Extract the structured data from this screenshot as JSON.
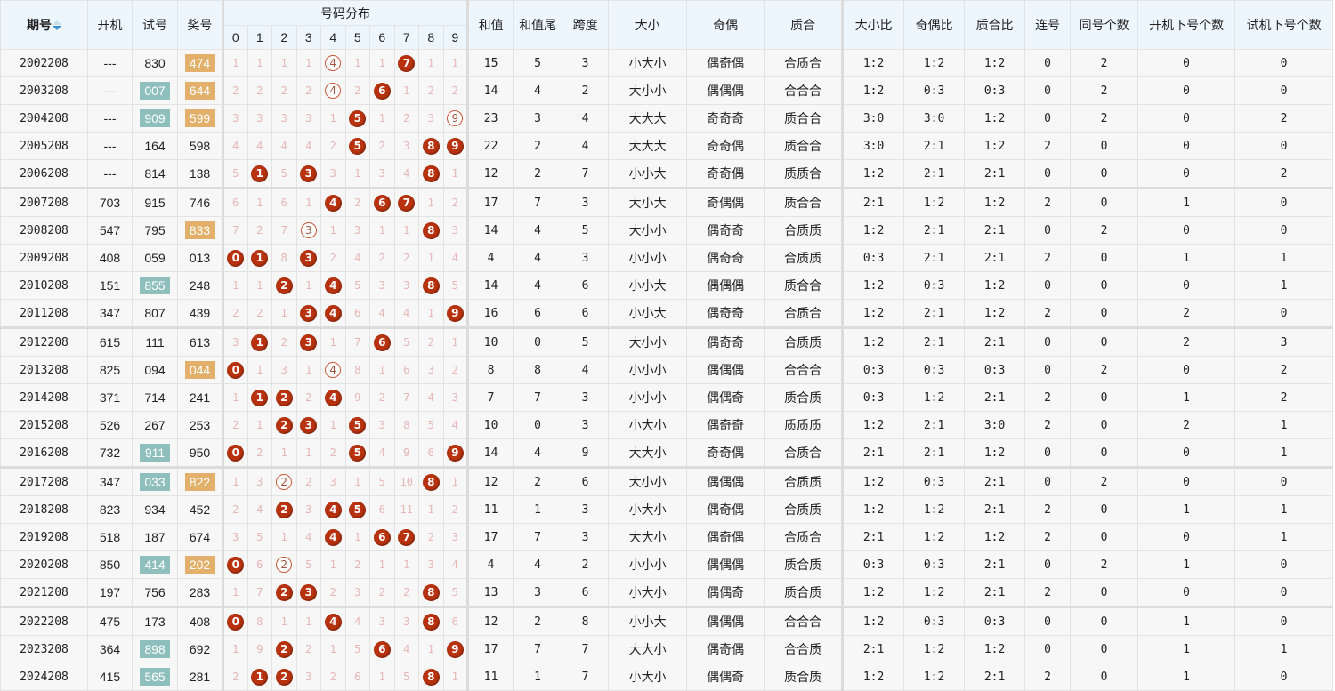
{
  "headers": {
    "issue": "期号",
    "open_machine": "开机",
    "test": "试号",
    "prize": "奖号",
    "distribution": "号码分布",
    "digits": [
      "0",
      "1",
      "2",
      "3",
      "4",
      "5",
      "6",
      "7",
      "8",
      "9"
    ],
    "sum": "和值",
    "sum_tail": "和值尾",
    "span": "跨度",
    "big_small": "大小",
    "odd_even": "奇偶",
    "prime_comp": "质合",
    "big_small_ratio": "大小比",
    "odd_even_ratio": "奇偶比",
    "prime_comp_ratio": "质合比",
    "consecutive": "连号",
    "same_count": "同号个数",
    "open_next_count": "开机下号个数",
    "test_next_count": "试机下号个数"
  },
  "sort_icon": "sort-updown-icon",
  "colors": {
    "ball": "#b8320f",
    "pair_ring": "#c9583a",
    "test_highlight": "#8fbfbd",
    "prize_highlight": "#e2b06a",
    "miss_text": "#e7b7b7",
    "header_bg": "#eef6fd"
  },
  "rows": [
    {
      "issue": "2002208",
      "open": "---",
      "test": "830",
      "test_hl": false,
      "prize": "474",
      "prize_hl": true,
      "dist": [
        "1",
        "1",
        "1",
        "1",
        "P4",
        "1",
        "1",
        "B7",
        "1",
        "1"
      ],
      "sum": "15",
      "tail": "5",
      "span": "3",
      "bs": "小大小",
      "oe": "偶奇偶",
      "pc": "合质合",
      "bsr": "1:2",
      "oer": "1:2",
      "pcr": "1:2",
      "cons": "0",
      "same": "2",
      "onext": "0",
      "tnext": "0"
    },
    {
      "issue": "2003208",
      "open": "---",
      "test": "007",
      "test_hl": true,
      "prize": "644",
      "prize_hl": true,
      "dist": [
        "2",
        "2",
        "2",
        "2",
        "P4",
        "2",
        "B6",
        "1",
        "2",
        "2"
      ],
      "sum": "14",
      "tail": "4",
      "span": "2",
      "bs": "大小小",
      "oe": "偶偶偶",
      "pc": "合合合",
      "bsr": "1:2",
      "oer": "0:3",
      "pcr": "0:3",
      "cons": "0",
      "same": "2",
      "onext": "0",
      "tnext": "0"
    },
    {
      "issue": "2004208",
      "open": "---",
      "test": "909",
      "test_hl": true,
      "prize": "599",
      "prize_hl": true,
      "dist": [
        "3",
        "3",
        "3",
        "3",
        "1",
        "B5",
        "1",
        "2",
        "3",
        "P9"
      ],
      "sum": "23",
      "tail": "3",
      "span": "4",
      "bs": "大大大",
      "oe": "奇奇奇",
      "pc": "质合合",
      "bsr": "3:0",
      "oer": "3:0",
      "pcr": "1:2",
      "cons": "0",
      "same": "2",
      "onext": "0",
      "tnext": "2"
    },
    {
      "issue": "2005208",
      "open": "---",
      "test": "164",
      "test_hl": false,
      "prize": "598",
      "prize_hl": false,
      "dist": [
        "4",
        "4",
        "4",
        "4",
        "2",
        "B5",
        "2",
        "3",
        "B8",
        "B9"
      ],
      "sum": "22",
      "tail": "2",
      "span": "4",
      "bs": "大大大",
      "oe": "奇奇偶",
      "pc": "质合合",
      "bsr": "3:0",
      "oer": "2:1",
      "pcr": "1:2",
      "cons": "2",
      "same": "0",
      "onext": "0",
      "tnext": "0"
    },
    {
      "issue": "2006208",
      "open": "---",
      "test": "814",
      "test_hl": false,
      "prize": "138",
      "prize_hl": false,
      "dist": [
        "5",
        "B1",
        "5",
        "B3",
        "3",
        "1",
        "3",
        "4",
        "B8",
        "1"
      ],
      "sum": "12",
      "tail": "2",
      "span": "7",
      "bs": "小小大",
      "oe": "奇奇偶",
      "pc": "质质合",
      "bsr": "1:2",
      "oer": "2:1",
      "pcr": "2:1",
      "cons": "0",
      "same": "0",
      "onext": "0",
      "tnext": "2"
    },
    {
      "issue": "2007208",
      "open": "703",
      "test": "915",
      "test_hl": false,
      "prize": "746",
      "prize_hl": false,
      "dist": [
        "6",
        "1",
        "6",
        "1",
        "B4",
        "2",
        "B6",
        "B7",
        "1",
        "2"
      ],
      "sum": "17",
      "tail": "7",
      "span": "3",
      "bs": "大小大",
      "oe": "奇偶偶",
      "pc": "质合合",
      "bsr": "2:1",
      "oer": "1:2",
      "pcr": "1:2",
      "cons": "2",
      "same": "0",
      "onext": "1",
      "tnext": "0"
    },
    {
      "issue": "2008208",
      "open": "547",
      "test": "795",
      "test_hl": false,
      "prize": "833",
      "prize_hl": true,
      "dist": [
        "7",
        "2",
        "7",
        "P3",
        "1",
        "3",
        "1",
        "1",
        "B8",
        "3"
      ],
      "sum": "14",
      "tail": "4",
      "span": "5",
      "bs": "大小小",
      "oe": "偶奇奇",
      "pc": "合质质",
      "bsr": "1:2",
      "oer": "2:1",
      "pcr": "2:1",
      "cons": "0",
      "same": "2",
      "onext": "0",
      "tnext": "0"
    },
    {
      "issue": "2009208",
      "open": "408",
      "test": "059",
      "test_hl": false,
      "prize": "013",
      "prize_hl": false,
      "dist": [
        "B0",
        "B1",
        "8",
        "B3",
        "2",
        "4",
        "2",
        "2",
        "1",
        "4"
      ],
      "sum": "4",
      "tail": "4",
      "span": "3",
      "bs": "小小小",
      "oe": "偶奇奇",
      "pc": "合质质",
      "bsr": "0:3",
      "oer": "2:1",
      "pcr": "2:1",
      "cons": "2",
      "same": "0",
      "onext": "1",
      "tnext": "1"
    },
    {
      "issue": "2010208",
      "open": "151",
      "test": "855",
      "test_hl": true,
      "prize": "248",
      "prize_hl": false,
      "dist": [
        "1",
        "1",
        "B2",
        "1",
        "B4",
        "5",
        "3",
        "3",
        "B8",
        "5"
      ],
      "sum": "14",
      "tail": "4",
      "span": "6",
      "bs": "小小大",
      "oe": "偶偶偶",
      "pc": "质合合",
      "bsr": "1:2",
      "oer": "0:3",
      "pcr": "1:2",
      "cons": "0",
      "same": "0",
      "onext": "0",
      "tnext": "1"
    },
    {
      "issue": "2011208",
      "open": "347",
      "test": "807",
      "test_hl": false,
      "prize": "439",
      "prize_hl": false,
      "dist": [
        "2",
        "2",
        "1",
        "B3",
        "B4",
        "6",
        "4",
        "4",
        "1",
        "B9"
      ],
      "sum": "16",
      "tail": "6",
      "span": "6",
      "bs": "小小大",
      "oe": "偶奇奇",
      "pc": "合质合",
      "bsr": "1:2",
      "oer": "2:1",
      "pcr": "1:2",
      "cons": "2",
      "same": "0",
      "onext": "2",
      "tnext": "0"
    },
    {
      "issue": "2012208",
      "open": "615",
      "test": "111",
      "test_hl": false,
      "prize": "613",
      "prize_hl": false,
      "dist": [
        "3",
        "B1",
        "2",
        "B3",
        "1",
        "7",
        "B6",
        "5",
        "2",
        "1"
      ],
      "sum": "10",
      "tail": "0",
      "span": "5",
      "bs": "大小小",
      "oe": "偶奇奇",
      "pc": "合质质",
      "bsr": "1:2",
      "oer": "2:1",
      "pcr": "2:1",
      "cons": "0",
      "same": "0",
      "onext": "2",
      "tnext": "3"
    },
    {
      "issue": "2013208",
      "open": "825",
      "test": "094",
      "test_hl": false,
      "prize": "044",
      "prize_hl": true,
      "dist": [
        "B0",
        "1",
        "3",
        "1",
        "P4",
        "8",
        "1",
        "6",
        "3",
        "2"
      ],
      "sum": "8",
      "tail": "8",
      "span": "4",
      "bs": "小小小",
      "oe": "偶偶偶",
      "pc": "合合合",
      "bsr": "0:3",
      "oer": "0:3",
      "pcr": "0:3",
      "cons": "0",
      "same": "2",
      "onext": "0",
      "tnext": "2"
    },
    {
      "issue": "2014208",
      "open": "371",
      "test": "714",
      "test_hl": false,
      "prize": "241",
      "prize_hl": false,
      "dist": [
        "1",
        "B1",
        "B2",
        "2",
        "B4",
        "9",
        "2",
        "7",
        "4",
        "3"
      ],
      "sum": "7",
      "tail": "7",
      "span": "3",
      "bs": "小小小",
      "oe": "偶偶奇",
      "pc": "质合质",
      "bsr": "0:3",
      "oer": "1:2",
      "pcr": "2:1",
      "cons": "2",
      "same": "0",
      "onext": "1",
      "tnext": "2"
    },
    {
      "issue": "2015208",
      "open": "526",
      "test": "267",
      "test_hl": false,
      "prize": "253",
      "prize_hl": false,
      "dist": [
        "2",
        "1",
        "B2",
        "B3",
        "1",
        "B5",
        "3",
        "8",
        "5",
        "4"
      ],
      "sum": "10",
      "tail": "0",
      "span": "3",
      "bs": "小大小",
      "oe": "偶奇奇",
      "pc": "质质质",
      "bsr": "1:2",
      "oer": "2:1",
      "pcr": "3:0",
      "cons": "2",
      "same": "0",
      "onext": "2",
      "tnext": "1"
    },
    {
      "issue": "2016208",
      "open": "732",
      "test": "911",
      "test_hl": true,
      "prize": "950",
      "prize_hl": false,
      "dist": [
        "B0",
        "2",
        "1",
        "1",
        "2",
        "B5",
        "4",
        "9",
        "6",
        "B9"
      ],
      "sum": "14",
      "tail": "4",
      "span": "9",
      "bs": "大大小",
      "oe": "奇奇偶",
      "pc": "合质合",
      "bsr": "2:1",
      "oer": "2:1",
      "pcr": "1:2",
      "cons": "0",
      "same": "0",
      "onext": "0",
      "tnext": "1"
    },
    {
      "issue": "2017208",
      "open": "347",
      "test": "033",
      "test_hl": true,
      "prize": "822",
      "prize_hl": true,
      "dist": [
        "1",
        "3",
        "P2",
        "2",
        "3",
        "1",
        "5",
        "10",
        "B8",
        "1"
      ],
      "sum": "12",
      "tail": "2",
      "span": "6",
      "bs": "大小小",
      "oe": "偶偶偶",
      "pc": "合质质",
      "bsr": "1:2",
      "oer": "0:3",
      "pcr": "2:1",
      "cons": "0",
      "same": "2",
      "onext": "0",
      "tnext": "0"
    },
    {
      "issue": "2018208",
      "open": "823",
      "test": "934",
      "test_hl": false,
      "prize": "452",
      "prize_hl": false,
      "dist": [
        "2",
        "4",
        "B2",
        "3",
        "B4",
        "B5",
        "6",
        "11",
        "1",
        "2"
      ],
      "sum": "11",
      "tail": "1",
      "span": "3",
      "bs": "小大小",
      "oe": "偶奇偶",
      "pc": "合质质",
      "bsr": "1:2",
      "oer": "1:2",
      "pcr": "2:1",
      "cons": "2",
      "same": "0",
      "onext": "1",
      "tnext": "1"
    },
    {
      "issue": "2019208",
      "open": "518",
      "test": "187",
      "test_hl": false,
      "prize": "674",
      "prize_hl": false,
      "dist": [
        "3",
        "5",
        "1",
        "4",
        "B4",
        "1",
        "B6",
        "B7",
        "2",
        "3"
      ],
      "sum": "17",
      "tail": "7",
      "span": "3",
      "bs": "大大小",
      "oe": "偶奇偶",
      "pc": "合质合",
      "bsr": "2:1",
      "oer": "1:2",
      "pcr": "1:2",
      "cons": "2",
      "same": "0",
      "onext": "0",
      "tnext": "1"
    },
    {
      "issue": "2020208",
      "open": "850",
      "test": "414",
      "test_hl": true,
      "prize": "202",
      "prize_hl": true,
      "dist": [
        "B0",
        "6",
        "P2",
        "5",
        "1",
        "2",
        "1",
        "1",
        "3",
        "4"
      ],
      "sum": "4",
      "tail": "4",
      "span": "2",
      "bs": "小小小",
      "oe": "偶偶偶",
      "pc": "质合质",
      "bsr": "0:3",
      "oer": "0:3",
      "pcr": "2:1",
      "cons": "0",
      "same": "2",
      "onext": "1",
      "tnext": "0"
    },
    {
      "issue": "2021208",
      "open": "197",
      "test": "756",
      "test_hl": false,
      "prize": "283",
      "prize_hl": false,
      "dist": [
        "1",
        "7",
        "B2",
        "B3",
        "2",
        "3",
        "2",
        "2",
        "B8",
        "5"
      ],
      "sum": "13",
      "tail": "3",
      "span": "6",
      "bs": "小大小",
      "oe": "偶偶奇",
      "pc": "质合质",
      "bsr": "1:2",
      "oer": "1:2",
      "pcr": "2:1",
      "cons": "2",
      "same": "0",
      "onext": "0",
      "tnext": "0"
    },
    {
      "issue": "2022208",
      "open": "475",
      "test": "173",
      "test_hl": false,
      "prize": "408",
      "prize_hl": false,
      "dist": [
        "B0",
        "8",
        "1",
        "1",
        "B4",
        "4",
        "3",
        "3",
        "B8",
        "6"
      ],
      "sum": "12",
      "tail": "2",
      "span": "8",
      "bs": "小小大",
      "oe": "偶偶偶",
      "pc": "合合合",
      "bsr": "1:2",
      "oer": "0:3",
      "pcr": "0:3",
      "cons": "0",
      "same": "0",
      "onext": "1",
      "tnext": "0"
    },
    {
      "issue": "2023208",
      "open": "364",
      "test": "898",
      "test_hl": true,
      "prize": "692",
      "prize_hl": false,
      "dist": [
        "1",
        "9",
        "B2",
        "2",
        "1",
        "5",
        "B6",
        "4",
        "1",
        "B9"
      ],
      "sum": "17",
      "tail": "7",
      "span": "7",
      "bs": "大大小",
      "oe": "偶奇偶",
      "pc": "合合质",
      "bsr": "2:1",
      "oer": "1:2",
      "pcr": "1:2",
      "cons": "0",
      "same": "0",
      "onext": "1",
      "tnext": "1"
    },
    {
      "issue": "2024208",
      "open": "415",
      "test": "565",
      "test_hl": true,
      "prize": "281",
      "prize_hl": false,
      "dist": [
        "2",
        "B1",
        "B2",
        "3",
        "2",
        "6",
        "1",
        "5",
        "B8",
        "1"
      ],
      "sum": "11",
      "tail": "1",
      "span": "7",
      "bs": "小大小",
      "oe": "偶偶奇",
      "pc": "质合质",
      "bsr": "1:2",
      "oer": "1:2",
      "pcr": "2:1",
      "cons": "2",
      "same": "0",
      "onext": "1",
      "tnext": "0"
    }
  ]
}
